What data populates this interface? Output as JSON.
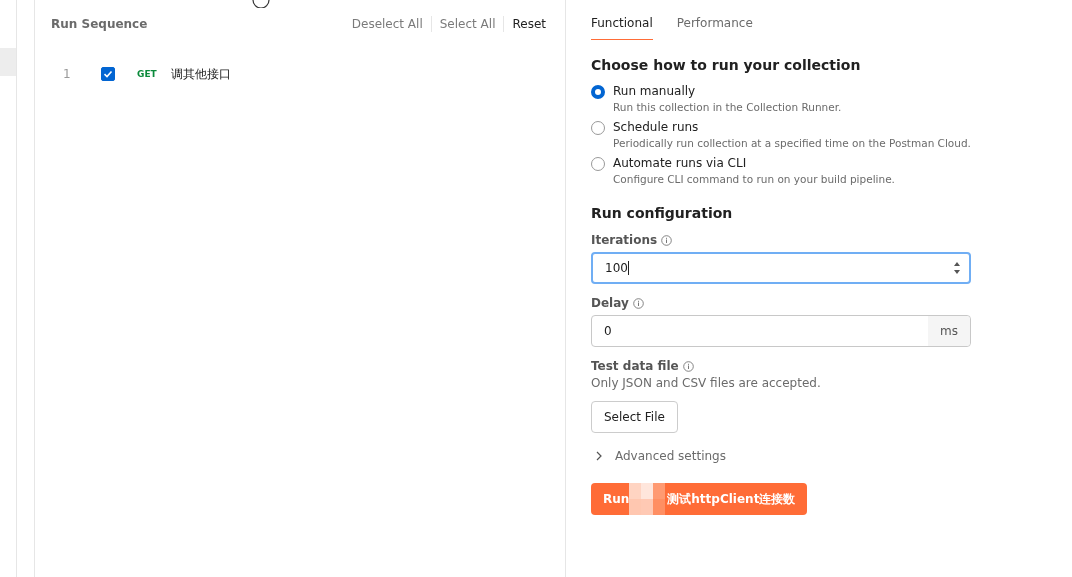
{
  "sequence": {
    "title": "Run Sequence",
    "actions": [
      {
        "label": "Deselect All",
        "disabled": true
      },
      {
        "label": "Select All",
        "disabled": true
      },
      {
        "label": "Reset",
        "disabled": false
      }
    ],
    "requests": [
      {
        "index": "1",
        "checked": true,
        "method": "GET",
        "name": "调其他接口"
      }
    ]
  },
  "tabs": [
    {
      "label": "Functional",
      "selected": true
    },
    {
      "label": "Performance",
      "selected": false
    }
  ],
  "run_mode": {
    "heading": "Choose how to run your collection",
    "options": [
      {
        "label": "Run manually",
        "description": "Run this collection in the Collection Runner.",
        "selected": true
      },
      {
        "label": "Schedule runs",
        "description": "Periodically run collection at a specified time on the Postman Cloud.",
        "selected": false
      },
      {
        "label": "Automate runs via CLI",
        "description": "Configure CLI command to run on your build pipeline.",
        "selected": false
      }
    ]
  },
  "config": {
    "heading": "Run configuration",
    "iterations": {
      "label": "Iterations",
      "value": "100"
    },
    "delay": {
      "label": "Delay",
      "value": "0",
      "unit": "ms"
    },
    "test_data": {
      "label": "Test data file",
      "hint": "Only JSON and CSV files are accepted.",
      "button": "Select File"
    },
    "advanced": {
      "label": "Advanced settings",
      "expanded": false
    }
  },
  "run_button": {
    "prefix": "Run",
    "suffix": "测试httpClient连接数"
  }
}
